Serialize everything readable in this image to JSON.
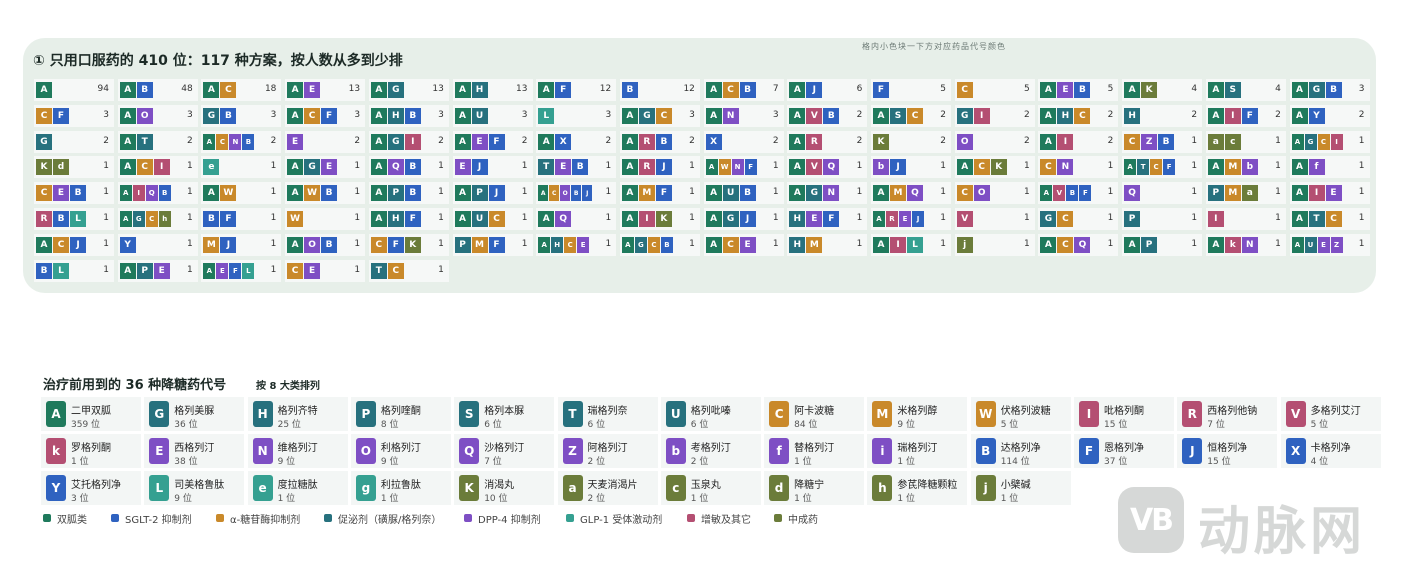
{
  "section1": {
    "title": "① 只用口服药的 410 位：117 种方案，按人数从多到少排",
    "note": "格内小色块一下方对应药品代号颜色"
  },
  "section2": {
    "title": "治疗前用到的 36 种降糖药代号",
    "subtitle": "按 8 大类排列"
  },
  "colors": {
    "biguanide": "#1f7a5c",
    "sglt2": "#2f62c0",
    "agi": "#c9892a",
    "secretagogue": "#27717e",
    "dpp4": "#7e4fc4",
    "glp1": "#35a091",
    "sensitizer": "#b44f72",
    "tcm": "#6b7c3a"
  },
  "legend": [
    {
      "label": "双胍类",
      "cls": "biguanide"
    },
    {
      "label": "SGLT-2 抑制剂",
      "cls": "sglt2"
    },
    {
      "label": "α-糖苷酶抑制剂",
      "cls": "agi"
    },
    {
      "label": "促泌剂（磺脲/格列奈）",
      "cls": "secretagogue"
    },
    {
      "label": "DPP-4 抑制剂",
      "cls": "dpp4"
    },
    {
      "label": "GLP-1 受体激动剂",
      "cls": "glp1"
    },
    {
      "label": "增敏及其它",
      "cls": "sensitizer"
    },
    {
      "label": "中成药",
      "cls": "tcm"
    }
  ],
  "drugs": [
    {
      "code": "A",
      "name": "二甲双胍",
      "count": "359 位",
      "cls": "biguanide"
    },
    {
      "code": "G",
      "name": "格列美脲",
      "count": "36 位",
      "cls": "secretagogue"
    },
    {
      "code": "H",
      "name": "格列齐特",
      "count": "25 位",
      "cls": "secretagogue"
    },
    {
      "code": "P",
      "name": "格列喹酮",
      "count": "8 位",
      "cls": "secretagogue"
    },
    {
      "code": "S",
      "name": "格列本脲",
      "count": "6 位",
      "cls": "secretagogue"
    },
    {
      "code": "T",
      "name": "瑞格列奈",
      "count": "6 位",
      "cls": "secretagogue"
    },
    {
      "code": "U",
      "name": "格列吡嗪",
      "count": "6 位",
      "cls": "secretagogue"
    },
    {
      "code": "C",
      "name": "阿卡波糖",
      "count": "84 位",
      "cls": "agi"
    },
    {
      "code": "M",
      "name": "米格列醇",
      "count": "9 位",
      "cls": "agi"
    },
    {
      "code": "W",
      "name": "伏格列波糖",
      "count": "5 位",
      "cls": "agi"
    },
    {
      "code": "I",
      "name": "吡格列酮",
      "count": "15 位",
      "cls": "sensitizer"
    },
    {
      "code": "R",
      "name": "西格列他钠",
      "count": "7 位",
      "cls": "sensitizer"
    },
    {
      "code": "V",
      "name": "多格列艾汀",
      "count": "5 位",
      "cls": "sensitizer"
    },
    {
      "code": "k",
      "name": "罗格列酮",
      "count": "1 位",
      "cls": "sensitizer"
    },
    {
      "code": "E",
      "name": "西格列汀",
      "count": "38 位",
      "cls": "dpp4"
    },
    {
      "code": "N",
      "name": "维格列汀",
      "count": "9 位",
      "cls": "dpp4"
    },
    {
      "code": "O",
      "name": "利格列汀",
      "count": "9 位",
      "cls": "dpp4"
    },
    {
      "code": "Q",
      "name": "沙格列汀",
      "count": "7 位",
      "cls": "dpp4"
    },
    {
      "code": "Z",
      "name": "阿格列汀",
      "count": "2 位",
      "cls": "dpp4"
    },
    {
      "code": "b",
      "name": "考格列汀",
      "count": "2 位",
      "cls": "dpp4"
    },
    {
      "code": "f",
      "name": "替格列汀",
      "count": "1 位",
      "cls": "dpp4"
    },
    {
      "code": "i",
      "name": "瑞格列汀",
      "count": "1 位",
      "cls": "dpp4"
    },
    {
      "code": "B",
      "name": "达格列净",
      "count": "114 位",
      "cls": "sglt2"
    },
    {
      "code": "F",
      "name": "恩格列净",
      "count": "37 位",
      "cls": "sglt2"
    },
    {
      "code": "J",
      "name": "恒格列净",
      "count": "15 位",
      "cls": "sglt2"
    },
    {
      "code": "X",
      "name": "卡格列净",
      "count": "4 位",
      "cls": "sglt2"
    },
    {
      "code": "Y",
      "name": "艾托格列净",
      "count": "3 位",
      "cls": "sglt2"
    },
    {
      "code": "L",
      "name": "司美格鲁肽",
      "count": "9 位",
      "cls": "glp1"
    },
    {
      "code": "e",
      "name": "度拉糖肽",
      "count": "1 位",
      "cls": "glp1"
    },
    {
      "code": "g",
      "name": "利拉鲁肽",
      "count": "1 位",
      "cls": "glp1"
    },
    {
      "code": "K",
      "name": "消渴丸",
      "count": "10 位",
      "cls": "tcm"
    },
    {
      "code": "a",
      "name": "天麦消渴片",
      "count": "2 位",
      "cls": "tcm"
    },
    {
      "code": "c",
      "name": "玉泉丸",
      "count": "1 位",
      "cls": "tcm"
    },
    {
      "code": "d",
      "name": "降糖宁",
      "count": "1 位",
      "cls": "tcm"
    },
    {
      "code": "h",
      "name": "参芪降糖颗粒",
      "count": "1 位",
      "cls": "tcm"
    },
    {
      "code": "j",
      "name": "小檗碱",
      "count": "1 位",
      "cls": "tcm"
    }
  ],
  "chart_data": {
    "type": "table",
    "title": "① 只用口服药的 410 位：117 种方案，按人数从多到少排",
    "regimens": [
      {
        "codes": "A",
        "count": 94
      },
      {
        "codes": "AB",
        "count": 48
      },
      {
        "codes": "AC",
        "count": 18
      },
      {
        "codes": "AE",
        "count": 13
      },
      {
        "codes": "AG",
        "count": 13
      },
      {
        "codes": "AH",
        "count": 13
      },
      {
        "codes": "AF",
        "count": 12
      },
      {
        "codes": "B",
        "count": 12
      },
      {
        "codes": "ACB",
        "count": 7
      },
      {
        "codes": "AJ",
        "count": 6
      },
      {
        "codes": "F",
        "count": 5
      },
      {
        "codes": "C",
        "count": 5
      },
      {
        "codes": "AEB",
        "count": 5
      },
      {
        "codes": "AK",
        "count": 4
      },
      {
        "codes": "AS",
        "count": 4
      },
      {
        "codes": "AGB",
        "count": 3
      },
      {
        "codes": "CF",
        "count": 3
      },
      {
        "codes": "AO",
        "count": 3
      },
      {
        "codes": "GB",
        "count": 3
      },
      {
        "codes": "ACF",
        "count": 3
      },
      {
        "codes": "AHB",
        "count": 3
      },
      {
        "codes": "AU",
        "count": 3
      },
      {
        "codes": "L",
        "count": 3
      },
      {
        "codes": "AGC",
        "count": 3
      },
      {
        "codes": "AN",
        "count": 3
      },
      {
        "codes": "AVB",
        "count": 2
      },
      {
        "codes": "ASC",
        "count": 2
      },
      {
        "codes": "GI",
        "count": 2
      },
      {
        "codes": "AHC",
        "count": 2
      },
      {
        "codes": "H",
        "count": 2
      },
      {
        "codes": "AIF",
        "count": 2
      },
      {
        "codes": "AY",
        "count": 2
      },
      {
        "codes": "G",
        "count": 2
      },
      {
        "codes": "AT",
        "count": 2
      },
      {
        "codes": "ACNB",
        "count": 2
      },
      {
        "codes": "E",
        "count": 2
      },
      {
        "codes": "AGI",
        "count": 2
      },
      {
        "codes": "AEF",
        "count": 2
      },
      {
        "codes": "AX",
        "count": 2
      },
      {
        "codes": "ARB",
        "count": 2
      },
      {
        "codes": "X",
        "count": 2
      },
      {
        "codes": "AR",
        "count": 2
      },
      {
        "codes": "K",
        "count": 2
      },
      {
        "codes": "O",
        "count": 2
      },
      {
        "codes": "AI",
        "count": 2
      },
      {
        "codes": "CZB",
        "count": 1
      },
      {
        "codes": "ac",
        "count": 1
      },
      {
        "codes": "AGCI",
        "count": 1
      },
      {
        "codes": "Kd",
        "count": 1
      },
      {
        "codes": "ACI",
        "count": 1
      },
      {
        "codes": "e",
        "count": 1
      },
      {
        "codes": "AGE",
        "count": 1
      },
      {
        "codes": "AQB",
        "count": 1
      },
      {
        "codes": "EJ",
        "count": 1
      },
      {
        "codes": "TEB",
        "count": 1
      },
      {
        "codes": "ARJ",
        "count": 1
      },
      {
        "codes": "AWNF",
        "count": 1
      },
      {
        "codes": "AVQ",
        "count": 1
      },
      {
        "codes": "bJ",
        "count": 1
      },
      {
        "codes": "ACK",
        "count": 1
      },
      {
        "codes": "CN",
        "count": 1
      },
      {
        "codes": "ATCF",
        "count": 1
      },
      {
        "codes": "AMb",
        "count": 1
      },
      {
        "codes": "Af",
        "count": 1
      },
      {
        "codes": "CEB",
        "count": 1
      },
      {
        "codes": "AIQB",
        "count": 1
      },
      {
        "codes": "AW",
        "count": 1
      },
      {
        "codes": "AWB",
        "count": 1
      },
      {
        "codes": "APB",
        "count": 1
      },
      {
        "codes": "APJ",
        "count": 1
      },
      {
        "codes": "ACOBJ",
        "count": 1
      },
      {
        "codes": "AMF",
        "count": 1
      },
      {
        "codes": "AUB",
        "count": 1
      },
      {
        "codes": "AGN",
        "count": 1
      },
      {
        "codes": "AMQ",
        "count": 1
      },
      {
        "codes": "CO",
        "count": 1
      },
      {
        "codes": "AVBF",
        "count": 1
      },
      {
        "codes": "Q",
        "count": 1
      },
      {
        "codes": "PMa",
        "count": 1
      },
      {
        "codes": "AIE",
        "count": 1
      },
      {
        "codes": "RBL",
        "count": 1
      },
      {
        "codes": "AGCh",
        "count": 1
      },
      {
        "codes": "BF",
        "count": 1
      },
      {
        "codes": "W",
        "count": 1
      },
      {
        "codes": "AHF",
        "count": 1
      },
      {
        "codes": "AUC",
        "count": 1
      },
      {
        "codes": "AQ",
        "count": 1
      },
      {
        "codes": "AIK",
        "count": 1
      },
      {
        "codes": "AGJ",
        "count": 1
      },
      {
        "codes": "HEF",
        "count": 1
      },
      {
        "codes": "AREJ",
        "count": 1
      },
      {
        "codes": "V",
        "count": 1
      },
      {
        "codes": "GC",
        "count": 1
      },
      {
        "codes": "P",
        "count": 1
      },
      {
        "codes": "I",
        "count": 1
      },
      {
        "codes": "ATC",
        "count": 1
      },
      {
        "codes": "ACJ",
        "count": 1
      },
      {
        "codes": "Y",
        "count": 1
      },
      {
        "codes": "MJ",
        "count": 1
      },
      {
        "codes": "AOB",
        "count": 1
      },
      {
        "codes": "CFK",
        "count": 1
      },
      {
        "codes": "PMF",
        "count": 1
      },
      {
        "codes": "AHCE",
        "count": 1
      },
      {
        "codes": "AGCB",
        "count": 1
      },
      {
        "codes": "ACE",
        "count": 1
      },
      {
        "codes": "HM",
        "count": 1
      },
      {
        "codes": "AIL",
        "count": 1
      },
      {
        "codes": "j",
        "count": 1
      },
      {
        "codes": "ACQ",
        "count": 1
      },
      {
        "codes": "AP",
        "count": 1
      },
      {
        "codes": "AkN",
        "count": 1
      },
      {
        "codes": "AUEZ",
        "count": 1
      },
      {
        "codes": "BL",
        "count": 1
      },
      {
        "codes": "APE",
        "count": 1
      },
      {
        "codes": "AEFL",
        "count": 1
      },
      {
        "codes": "CE",
        "count": 1
      },
      {
        "codes": "TC",
        "count": 1
      }
    ]
  }
}
